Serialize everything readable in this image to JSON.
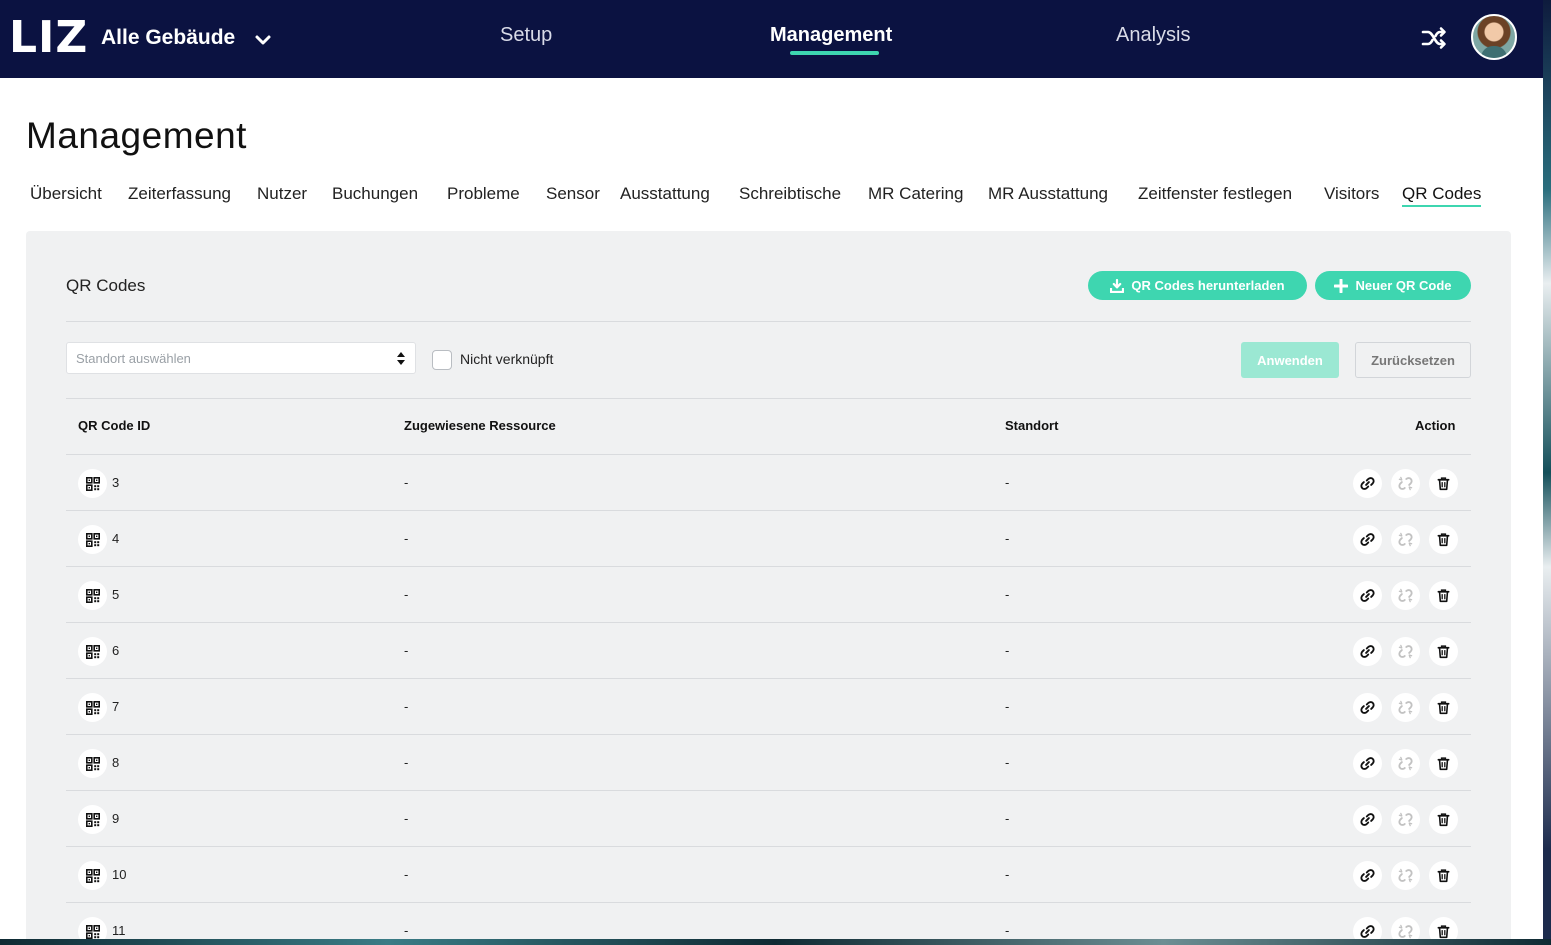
{
  "header": {
    "logo": "LIZ",
    "building_selector": "Alle Gebäude",
    "nav": [
      {
        "label": "Setup"
      },
      {
        "label": "Management",
        "active": true
      },
      {
        "label": "Analysis"
      }
    ],
    "accent_color": "#3ed6b0",
    "bar_color": "#0b1241"
  },
  "page": {
    "title": "Management",
    "tabs": [
      {
        "label": "Übersicht"
      },
      {
        "label": "Zeiterfassung"
      },
      {
        "label": "Nutzer"
      },
      {
        "label": "Buchungen"
      },
      {
        "label": "Probleme"
      },
      {
        "label": "Sensor"
      },
      {
        "label": "Ausstattung"
      },
      {
        "label": "Schreibtische"
      },
      {
        "label": "MR Catering"
      },
      {
        "label": "MR Ausstattung"
      },
      {
        "label": "Zeitfenster festlegen"
      },
      {
        "label": "Visitors"
      },
      {
        "label": "QR Codes",
        "active": true
      }
    ]
  },
  "panel": {
    "title": "QR Codes",
    "download_button": "QR Codes herunterladen",
    "new_button": "Neuer QR Code",
    "filter": {
      "location_placeholder": "Standort auswählen",
      "unlinked_label": "Nicht verknüpft",
      "unlinked_checked": false,
      "apply_button": "Anwenden",
      "reset_button": "Zurücksetzen"
    },
    "table": {
      "columns": [
        "QR Code ID",
        "Zugewiesene Ressource",
        "Standort",
        "Action"
      ],
      "rows": [
        {
          "id": "3",
          "resource": "-",
          "location": "-"
        },
        {
          "id": "4",
          "resource": "-",
          "location": "-"
        },
        {
          "id": "5",
          "resource": "-",
          "location": "-"
        },
        {
          "id": "6",
          "resource": "-",
          "location": "-"
        },
        {
          "id": "7",
          "resource": "-",
          "location": "-"
        },
        {
          "id": "8",
          "resource": "-",
          "location": "-"
        },
        {
          "id": "9",
          "resource": "-",
          "location": "-"
        },
        {
          "id": "10",
          "resource": "-",
          "location": "-"
        },
        {
          "id": "11",
          "resource": "-",
          "location": "-"
        }
      ],
      "row_actions": [
        {
          "icon": "link-icon",
          "enabled": true
        },
        {
          "icon": "unlink-icon",
          "enabled": false
        },
        {
          "icon": "trash-icon",
          "enabled": true
        }
      ]
    }
  }
}
